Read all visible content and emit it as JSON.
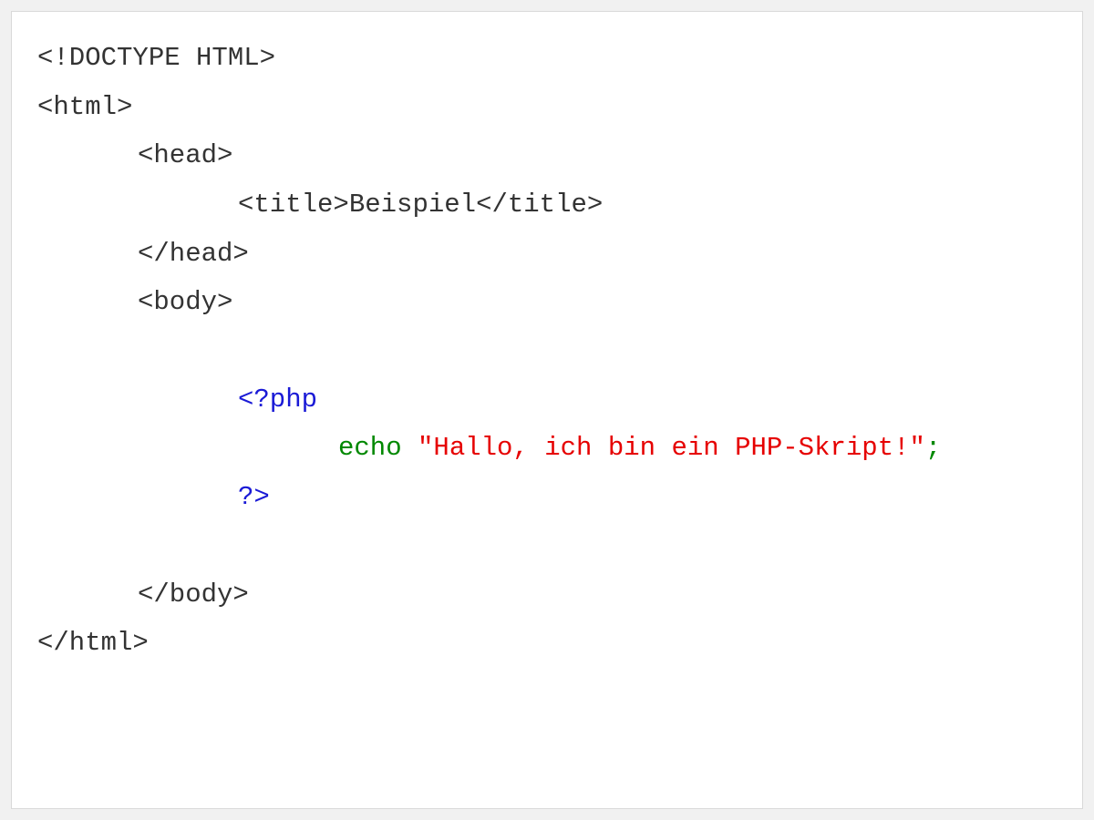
{
  "code": {
    "line1": "<!DOCTYPE HTML>",
    "line2": "<html>",
    "line3": "<head>",
    "line4_open": "<title>",
    "line4_text": "Beispiel",
    "line4_close": "</title>",
    "line5": "</head>",
    "line6": "<body>",
    "line7": "<?php",
    "line8_keyword": "echo ",
    "line8_string": "\"Hallo, ich bin ein PHP-Skript!\"",
    "line8_semi": ";",
    "line9": "?>",
    "line10": "</body>",
    "line11": "</html>"
  },
  "colors": {
    "background": "#f1f1f1",
    "container_bg": "#ffffff",
    "border": "#d9d9d9",
    "default_text": "#333333",
    "php_tag": "#1a1ad6",
    "keyword": "#008800",
    "string": "#e60000"
  }
}
